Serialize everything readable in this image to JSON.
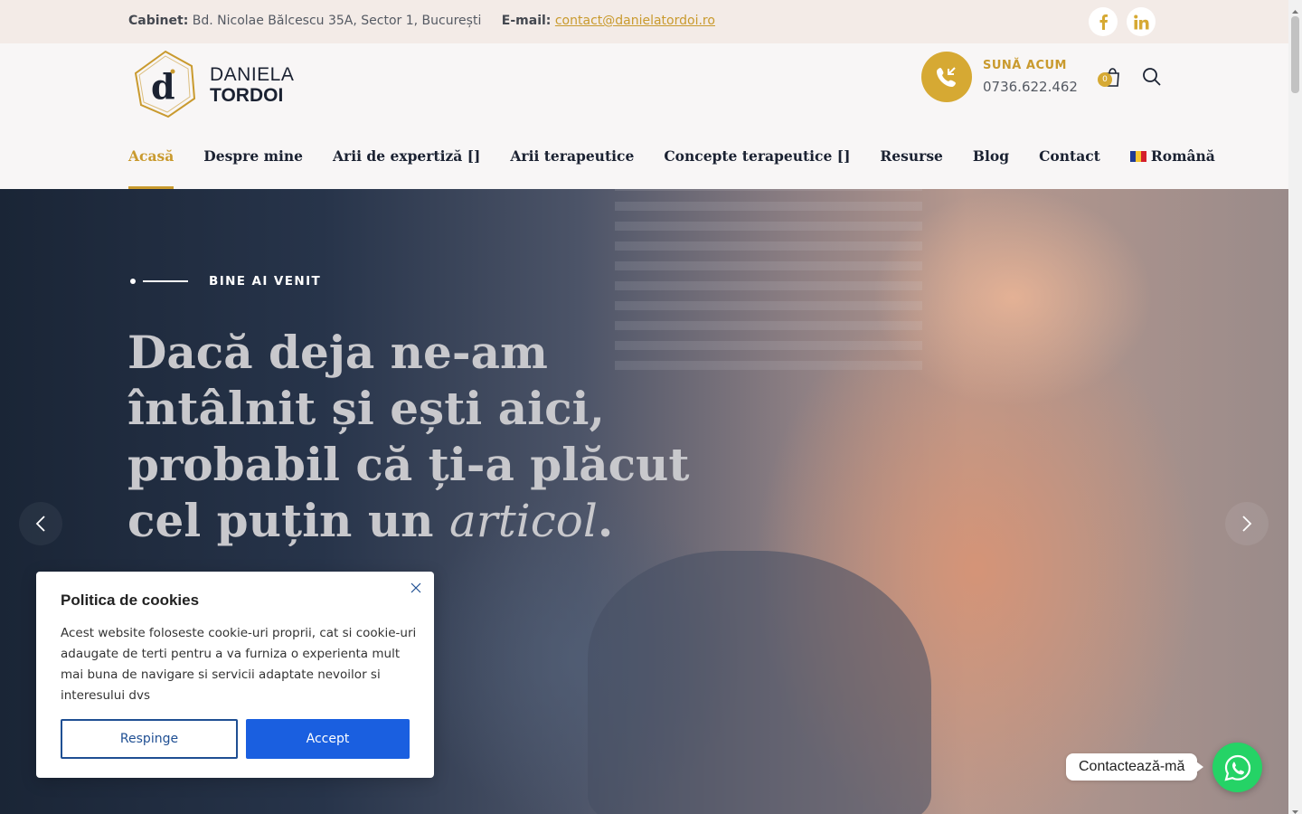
{
  "topbar": {
    "address_label": "Cabinet:",
    "address": "Bd. Nicolae Bălcescu 35A, Sector 1, București",
    "email_label": "E-mail:",
    "email": "contact@danielatordoi.ro"
  },
  "social": [
    "facebook-icon",
    "linkedin-icon"
  ],
  "logo": {
    "line1": "DANIELA",
    "line2": "TORDOI",
    "mark": "d"
  },
  "call": {
    "label": "SUNĂ ACUM",
    "phone": "0736.622.462"
  },
  "cart": {
    "count": "0"
  },
  "nav": {
    "items": [
      {
        "label": "Acasă",
        "active": true
      },
      {
        "label": "Despre mine"
      },
      {
        "label": "Arii de expertiză []"
      },
      {
        "label": "Arii terapeutice"
      },
      {
        "label": "Concepte terapeutice []"
      },
      {
        "label": "Resurse"
      },
      {
        "label": "Blog"
      },
      {
        "label": "Contact"
      },
      {
        "label": "Română"
      }
    ]
  },
  "hero": {
    "eyebrow": "BINE AI VENIT",
    "headline_main": "Dacă deja ne-am întâlnit și ești aici, probabil că ți-a plăcut cel puțin un ",
    "headline_em": "articol",
    "headline_end": "."
  },
  "cookie": {
    "title": "Politica de cookies",
    "body": "Acest website foloseste cookie-uri proprii, cat si cookie-uri adaugate de terti pentru a va furniza o experienta mult mai buna de navigare si servicii adaptate nevoilor si interesului dvs",
    "reject": "Respinge",
    "accept": "Accept"
  },
  "whatsapp": {
    "label": "Contactează-mă"
  },
  "colors": {
    "accent": "#c99a2e",
    "navy": "#1b2232",
    "topbar_bg": "#f3ebe7",
    "accept_blue": "#1a5fe0",
    "whatsapp": "#25d366"
  }
}
